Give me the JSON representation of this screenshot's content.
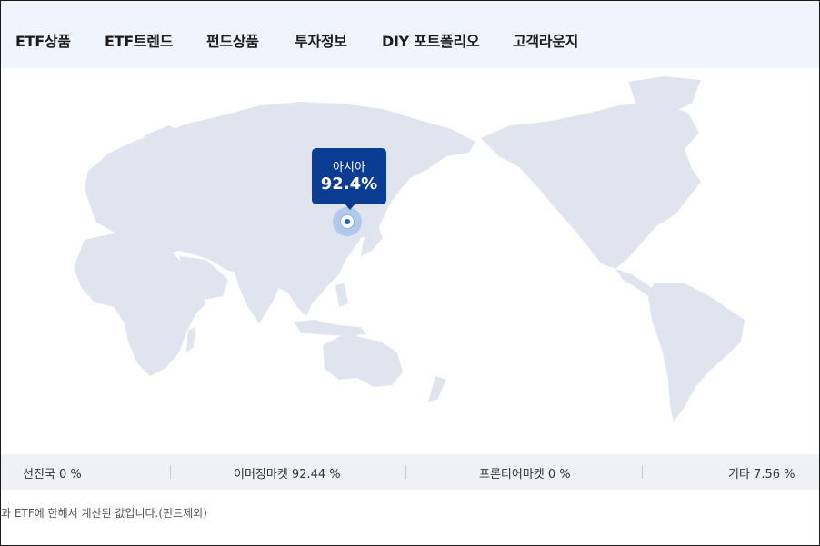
{
  "nav": {
    "items": [
      "ETF상품",
      "ETF트렌드",
      "펀드상품",
      "투자정보",
      "DIY 포트폴리오",
      "고객라운지"
    ]
  },
  "map": {
    "tooltip_region": "아시아",
    "tooltip_value": "92.4%"
  },
  "stats": [
    {
      "label": "선진국 0 %"
    },
    {
      "label": "이머징마켓 92.44 %"
    },
    {
      "label": "프론티어마켓 0 %"
    },
    {
      "label": "기타 7.56 %"
    }
  ],
  "note": "과 ETF에 한해서 계산된 값입니다.(펀드제외)",
  "colors": {
    "nav_bg": "#f0f4fc",
    "land": "#dfe4ee",
    "tooltip_bg": "#0b3c94",
    "marker": "#1e5fd8",
    "stats_bg": "#f0f1f4"
  }
}
